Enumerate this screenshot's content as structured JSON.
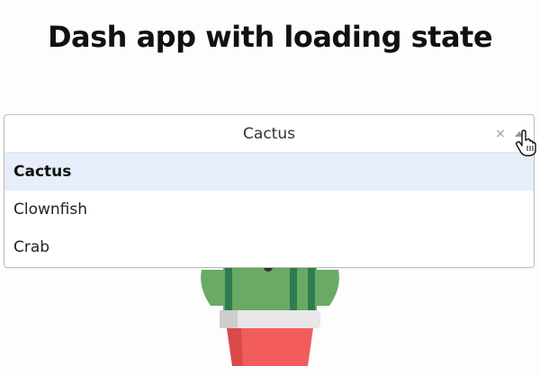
{
  "header": {
    "title": "Dash app with loading state"
  },
  "dropdown": {
    "selected_value": "Cactus",
    "clear_symbol": "×",
    "options": [
      {
        "label": "Cactus",
        "selected": true
      },
      {
        "label": "Clownfish",
        "selected": false
      },
      {
        "label": "Crab",
        "selected": false
      }
    ]
  },
  "icons": {
    "clear": "close-icon",
    "arrow": "chevron-up-icon",
    "cursor": "hand-pointer-icon",
    "illustration": "cactus-image"
  },
  "colors": {
    "selected_option_bg": "#e6eefc",
    "cactus_green": "#6aaa64",
    "pot_red": "#f25c5c"
  }
}
